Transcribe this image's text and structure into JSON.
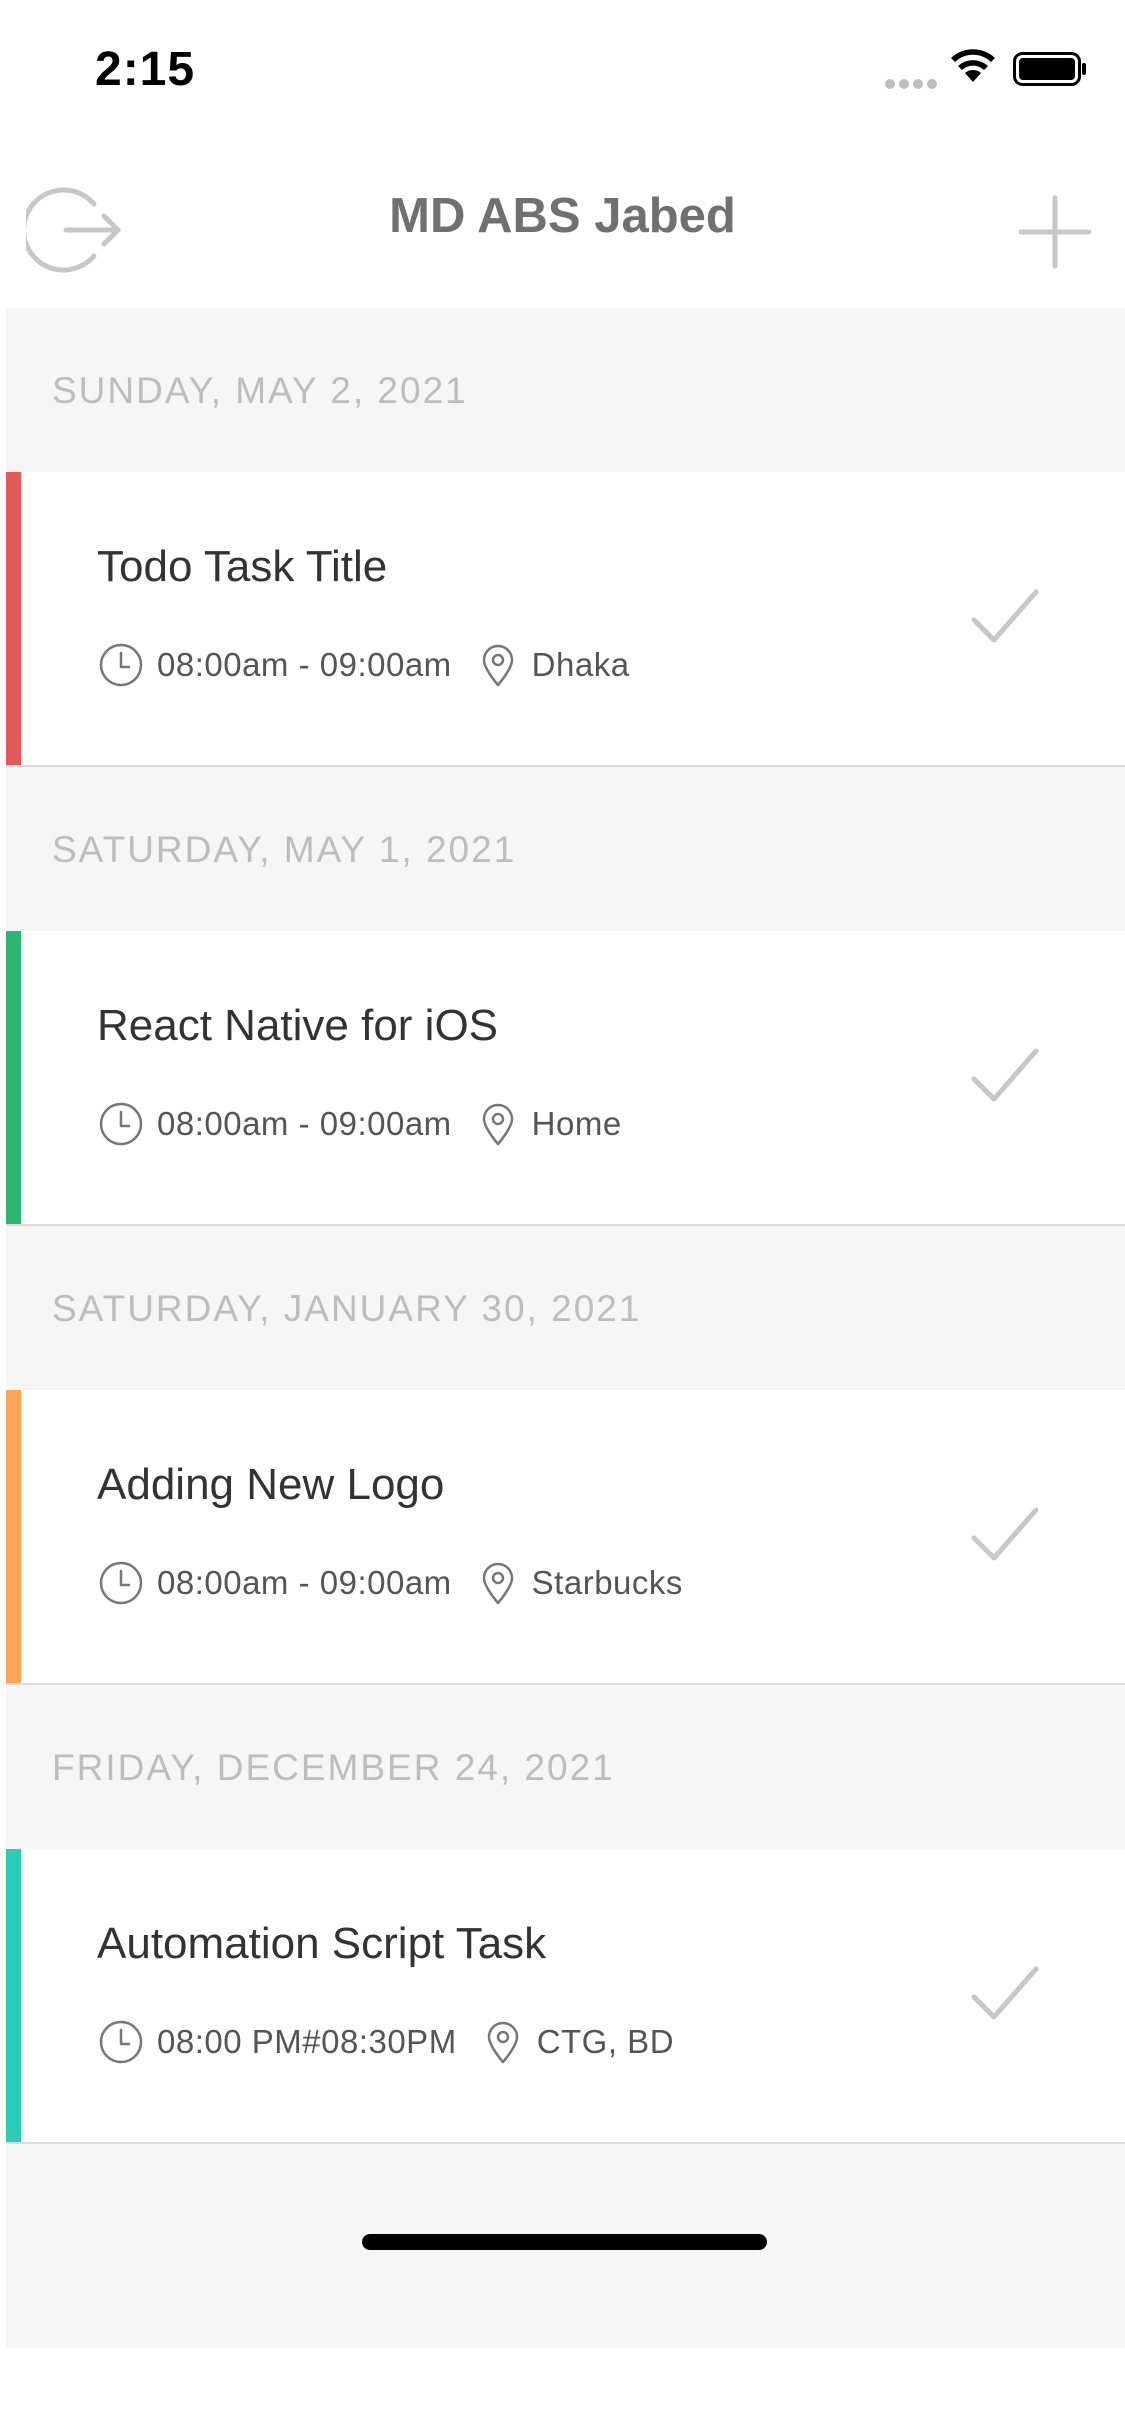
{
  "status_bar": {
    "time": "2:15"
  },
  "header": {
    "title": "MD ABS Jabed"
  },
  "sections": [
    {
      "date": "SUNDAY, MAY 2, 2021",
      "task": {
        "title": "Todo Task Title",
        "time": "08:00am - 09:00am",
        "location": "Dhaka",
        "color": "#e05a5a"
      }
    },
    {
      "date": "SATURDAY, MAY 1, 2021",
      "task": {
        "title": "React Native for iOS",
        "time": "08:00am - 09:00am",
        "location": "Home",
        "color": "#2bb673"
      }
    },
    {
      "date": "SATURDAY, JANUARY 30, 2021",
      "task": {
        "title": "Adding New Logo",
        "time": "08:00am - 09:00am",
        "location": "Starbucks",
        "color": "#f9a65a"
      }
    },
    {
      "date": "FRIDAY, DECEMBER 24, 2021",
      "task": {
        "title": "Automation Script Task",
        "time": "08:00 PM#08:30PM",
        "location": "CTG, BD",
        "color": "#2ccbb6"
      }
    }
  ],
  "icons": {
    "logout": "logout-icon",
    "add": "plus-icon",
    "clock": "clock-icon",
    "location": "location-pin-icon",
    "check": "checkmark-icon"
  }
}
